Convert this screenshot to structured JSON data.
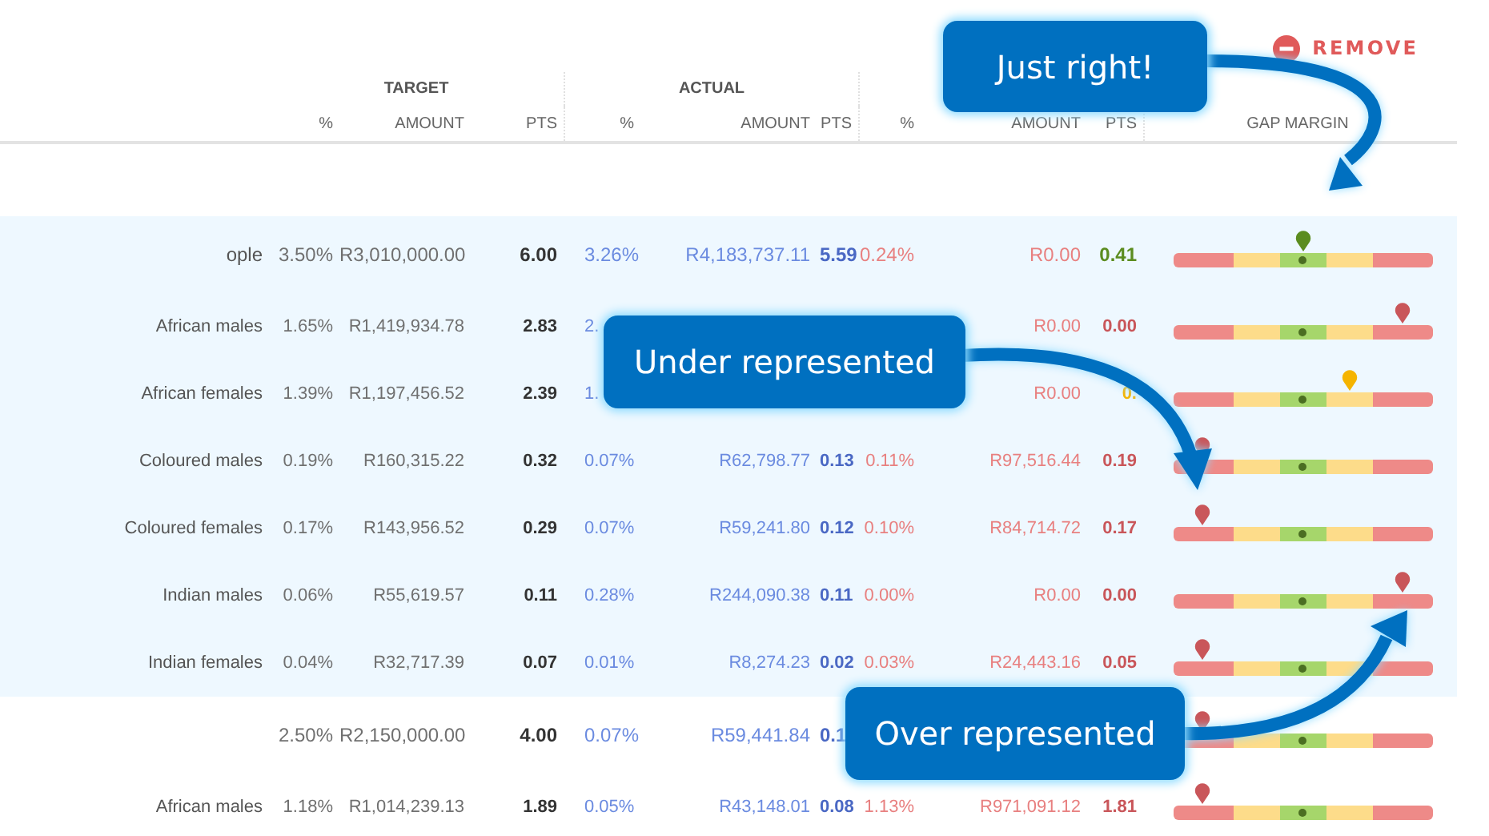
{
  "remove_button": {
    "label": "REMOVE"
  },
  "group_headers": [
    "TARGET",
    "ACTUAL"
  ],
  "column_headers": [
    "%",
    "AMOUNT",
    "PTS",
    "%",
    "AMOUNT",
    "PTS",
    "%",
    "AMOUNT",
    "PTS",
    "GAP MARGIN"
  ],
  "rows": [
    {
      "kind": "group",
      "highlighted": true,
      "label": "ople",
      "target_pct": "3.50%",
      "target_amount": "R3,010,000.00",
      "target_pts": "6.00",
      "actual_pct": "3.26%",
      "actual_amount": "R4,183,737.11",
      "actual_pts": "5.59",
      "gap_pct": "0.24%",
      "gap_amount": "R0.00",
      "gap_pts": "0.41",
      "margin": {
        "level": 0.5,
        "color": "#5b8c1f"
      }
    },
    {
      "kind": "item",
      "highlighted": true,
      "label": "African males",
      "target_pct": "1.65%",
      "target_amount": "R1,419,934.78",
      "target_pts": "2.83",
      "actual_pct": "2.",
      "gap_amount": "R0.00",
      "gap_pts": "0.00",
      "margin": {
        "level": 0.88,
        "color": "#c9565a"
      }
    },
    {
      "kind": "item",
      "highlighted": true,
      "label": "African females",
      "target_pct": "1.39%",
      "target_amount": "R1,197,456.52",
      "target_pts": "2.39",
      "actual_pct": "1.",
      "gap_amount": "R0.00",
      "gap_pts": "0.",
      "margin": {
        "level": 0.68,
        "color": "#f5b400"
      }
    },
    {
      "kind": "item",
      "highlighted": true,
      "label": "Coloured males",
      "target_pct": "0.19%",
      "target_amount": "R160,315.22",
      "target_pts": "0.32",
      "actual_pct": "0.07%",
      "actual_amount": "R62,798.77",
      "actual_pts": "0.13",
      "gap_pct": "0.11%",
      "gap_amount": "R97,516.44",
      "gap_pts": "0.19",
      "margin": {
        "level": 0.11,
        "color": "#c9565a"
      }
    },
    {
      "kind": "item",
      "highlighted": true,
      "label": "Coloured females",
      "target_pct": "0.17%",
      "target_amount": "R143,956.52",
      "target_pts": "0.29",
      "actual_pct": "0.07%",
      "actual_amount": "R59,241.80",
      "actual_pts": "0.12",
      "gap_pct": "0.10%",
      "gap_amount": "R84,714.72",
      "gap_pts": "0.17",
      "margin": {
        "level": 0.11,
        "color": "#c9565a"
      }
    },
    {
      "kind": "item",
      "highlighted": true,
      "label": "Indian males",
      "target_pct": "0.06%",
      "target_amount": "R55,619.57",
      "target_pts": "0.11",
      "actual_pct": "0.28%",
      "actual_amount": "R244,090.38",
      "actual_pts": "0.11",
      "gap_pct": "0.00%",
      "gap_amount": "R0.00",
      "gap_pts": "0.00",
      "margin": {
        "level": 0.88,
        "color": "#c9565a"
      }
    },
    {
      "kind": "item",
      "highlighted": true,
      "label": "Indian females",
      "target_pct": "0.04%",
      "target_amount": "R32,717.39",
      "target_pts": "0.07",
      "actual_pct": "0.01%",
      "actual_amount": "R8,274.23",
      "actual_pts": "0.02",
      "gap_pct": "0.03%",
      "gap_amount": "R24,443.16",
      "gap_pts": "0.05",
      "margin": {
        "level": 0.11,
        "color": "#c9565a"
      }
    },
    {
      "kind": "group",
      "highlighted": false,
      "target_pct": "2.50%",
      "target_amount": "R2,150,000.00",
      "target_pts": "4.00",
      "actual_pct": "0.07%",
      "actual_amount": "R59,441.84",
      "actual_pts": "0.1",
      "margin": {
        "level": 0.11,
        "color": "#c9565a"
      }
    },
    {
      "kind": "item",
      "highlighted": false,
      "label": "African males",
      "target_pct": "1.18%",
      "target_amount": "R1,014,239.13",
      "target_pts": "1.89",
      "actual_pct": "0.05%",
      "actual_amount": "R43,148.01",
      "actual_pts": "0.08",
      "gap_pct": "1.13%",
      "gap_amount": "R971,091.12",
      "gap_pts": "1.81",
      "margin": {
        "level": 0.11,
        "color": "#c9565a"
      }
    }
  ],
  "callouts": [
    {
      "text": "Just right!"
    },
    {
      "text": "Under represented"
    },
    {
      "text": "Over represented"
    }
  ]
}
